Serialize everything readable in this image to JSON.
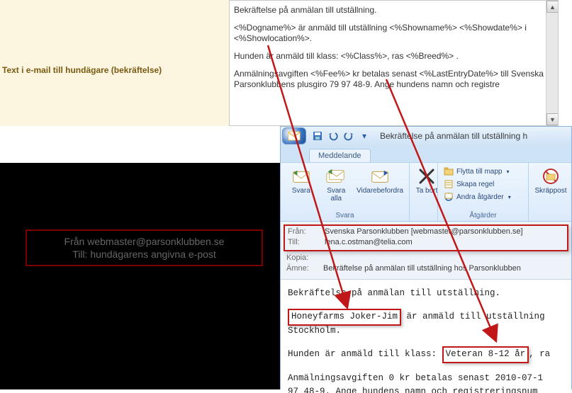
{
  "left_panel": {
    "label": "Text i e-mail till hundägare (bekräftelse)"
  },
  "template": {
    "line1": "Bekräftelse på anmälan till utställning.",
    "line2": "<%Dogname%> är anmäld till utställning <%Showname%> <%Showdate%> i <%Showlocation%>.",
    "line3": "Hunden är anmäld till klass: <%Class%>, ras <%Breed%> .",
    "line4": "Anmälningsavgiften <%Fee%> kr betalas senast <%LastEntryDate%> till Svenska Parsonklubbens plusgiro 79 97 48-9. Ange hundens namn och registre"
  },
  "dark_callout": {
    "line1": "Från webmaster@parsonklubben.se",
    "line2": "Till: hundägarens angivna e-post"
  },
  "outlook": {
    "title": "Bekräftelse på anmälan till utställning h",
    "tab": "Meddelande",
    "ribbon": {
      "reply": "Svara",
      "reply_all": "Svara alla",
      "forward": "Vidarebefordra",
      "group_reply": "Svara",
      "delete": "Ta bort",
      "move_to": "Flytta till mapp",
      "create_rule": "Skapa regel",
      "other_actions": "Andra åtgärder",
      "group_actions": "Åtgärder",
      "junk": "Skräppost"
    },
    "header": {
      "from_label": "Från:",
      "from_value": "Svenska Parsonklubben [webmaster@parsonklubben.se]",
      "to_label": "Till:",
      "to_value": "lena.c.ostman@telia.com",
      "cc_label": "Kopia:",
      "subject_label": "Ämne:",
      "subject_value": "Bekräftelse på anmälan till utställning hos Parsonklubben"
    },
    "body": {
      "p1": "Bekräftelse på anmälan till utställning.",
      "p2a": "Honeyfarms Joker-Jim",
      "p2b": " är anmäld till utställning ",
      "p2c": "Stockholm.",
      "p3a": "Hunden är anmäld till klass:",
      "p3b": "Veteran 8-12 år",
      "p3c": ", ra",
      "p4": "Anmälningsavgiften 0 kr betalas senast 2010-07-1",
      "p5": "97 48-9. Ange hundens namn och registreringsnum"
    }
  }
}
